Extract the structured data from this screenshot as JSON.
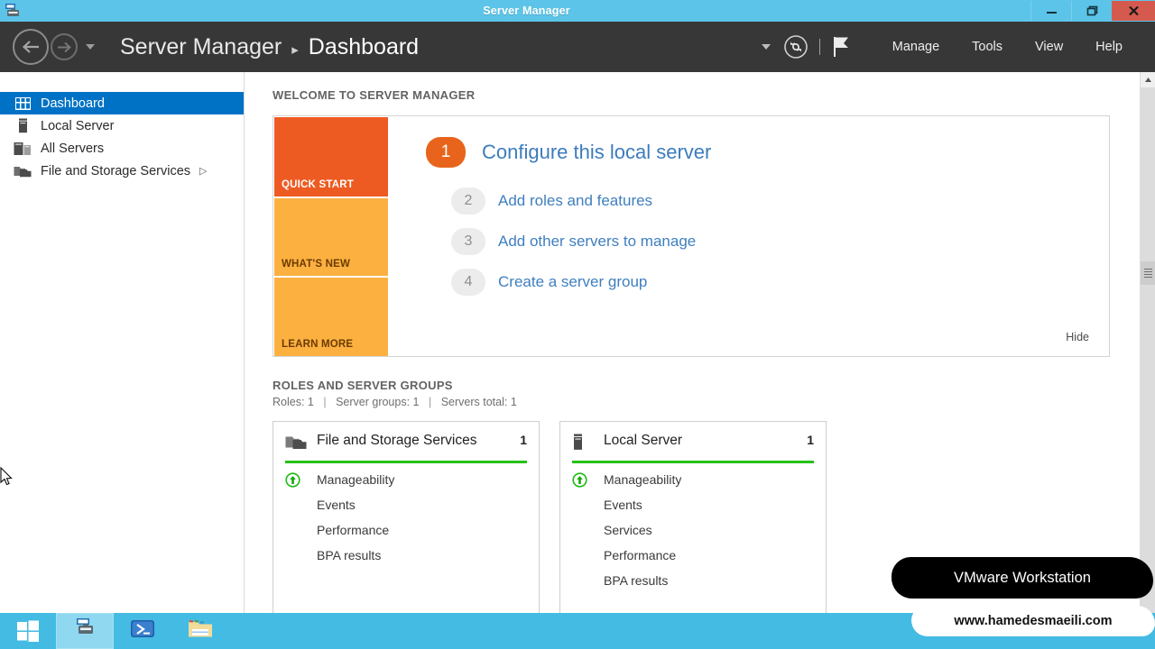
{
  "window": {
    "title": "Server Manager",
    "icon": "server-manager-icon",
    "controls": {
      "minimize": "minimize-icon",
      "restore": "restore-icon",
      "close": "close-icon"
    }
  },
  "navbar": {
    "back": "back-arrow-icon",
    "forward": "forward-arrow-icon",
    "history_caret": "chevron-down-icon",
    "breadcrumb": {
      "root": "Server Manager",
      "separator": "▸",
      "current": "Dashboard"
    },
    "caret": "chevron-down-icon",
    "refresh": "refresh-icon",
    "notifications": "flag-icon",
    "menus": [
      {
        "label": "Manage"
      },
      {
        "label": "Tools"
      },
      {
        "label": "View"
      },
      {
        "label": "Help"
      }
    ]
  },
  "sidebar": {
    "items": [
      {
        "label": "Dashboard",
        "icon": "dashboard-grid-icon",
        "active": true,
        "chevron": ""
      },
      {
        "label": "Local Server",
        "icon": "server-icon",
        "active": false,
        "chevron": ""
      },
      {
        "label": "All Servers",
        "icon": "servers-stack-icon",
        "active": false,
        "chevron": ""
      },
      {
        "label": "File and Storage Services",
        "icon": "folder-storage-icon",
        "active": false,
        "chevron": "▷"
      }
    ]
  },
  "main": {
    "welcome": {
      "heading": "WELCOME TO SERVER MANAGER",
      "tiles": [
        {
          "label": "QUICK START",
          "color": "#ee5b22"
        },
        {
          "label": "WHAT'S NEW",
          "color": "#fcb040"
        },
        {
          "label": "LEARN MORE",
          "color": "#fcb040"
        }
      ],
      "steps": [
        {
          "num": "1",
          "text": "Configure this local server"
        },
        {
          "num": "2",
          "text": "Add roles and features"
        },
        {
          "num": "3",
          "text": "Add other servers to manage"
        },
        {
          "num": "4",
          "text": "Create a server group"
        }
      ],
      "hide_label": "Hide"
    },
    "roles": {
      "heading": "ROLES AND SERVER GROUPS",
      "summary": [
        "Roles: 1",
        "Server groups: 1",
        "Servers total: 1"
      ],
      "separator": "|",
      "cards": [
        {
          "title": "File and Storage Services",
          "icon": "folder-storage-icon",
          "count": "1",
          "status_color": "#25c118",
          "rows": [
            {
              "label": "Manageability",
              "icon": "green-up-arrow-icon"
            },
            {
              "label": "Events",
              "icon": ""
            },
            {
              "label": "Performance",
              "icon": ""
            },
            {
              "label": "BPA results",
              "icon": ""
            }
          ]
        },
        {
          "title": "Local Server",
          "icon": "server-icon",
          "count": "1",
          "status_color": "#25c118",
          "rows": [
            {
              "label": "Manageability",
              "icon": "green-up-arrow-icon"
            },
            {
              "label": "Events",
              "icon": ""
            },
            {
              "label": "Services",
              "icon": ""
            },
            {
              "label": "Performance",
              "icon": ""
            },
            {
              "label": "BPA results",
              "icon": ""
            }
          ]
        }
      ]
    }
  },
  "scrollbar": {
    "up_arrow": "scroll-up-icon"
  },
  "taskbar": {
    "start": "windows-start-icon",
    "buttons": [
      {
        "name": "server-manager",
        "icon": "server-manager-icon",
        "active": true
      },
      {
        "name": "powershell",
        "icon": "powershell-icon",
        "active": false
      },
      {
        "name": "file-explorer",
        "icon": "file-explorer-icon",
        "active": false
      }
    ]
  },
  "watermark": {
    "app": "VMware Workstation",
    "site": "www.hamedesmaeili.com"
  },
  "colors": {
    "titlebar": "#5cc4e8",
    "navbar": "#373737",
    "accent_blue": "#0072c6",
    "link_blue": "#3f7fbf",
    "status_green": "#25c118",
    "quick_start_orange": "#ee5b22",
    "tile_amber": "#fcb040",
    "close_red": "#d55a4e",
    "taskbar": "#44bbe3"
  }
}
